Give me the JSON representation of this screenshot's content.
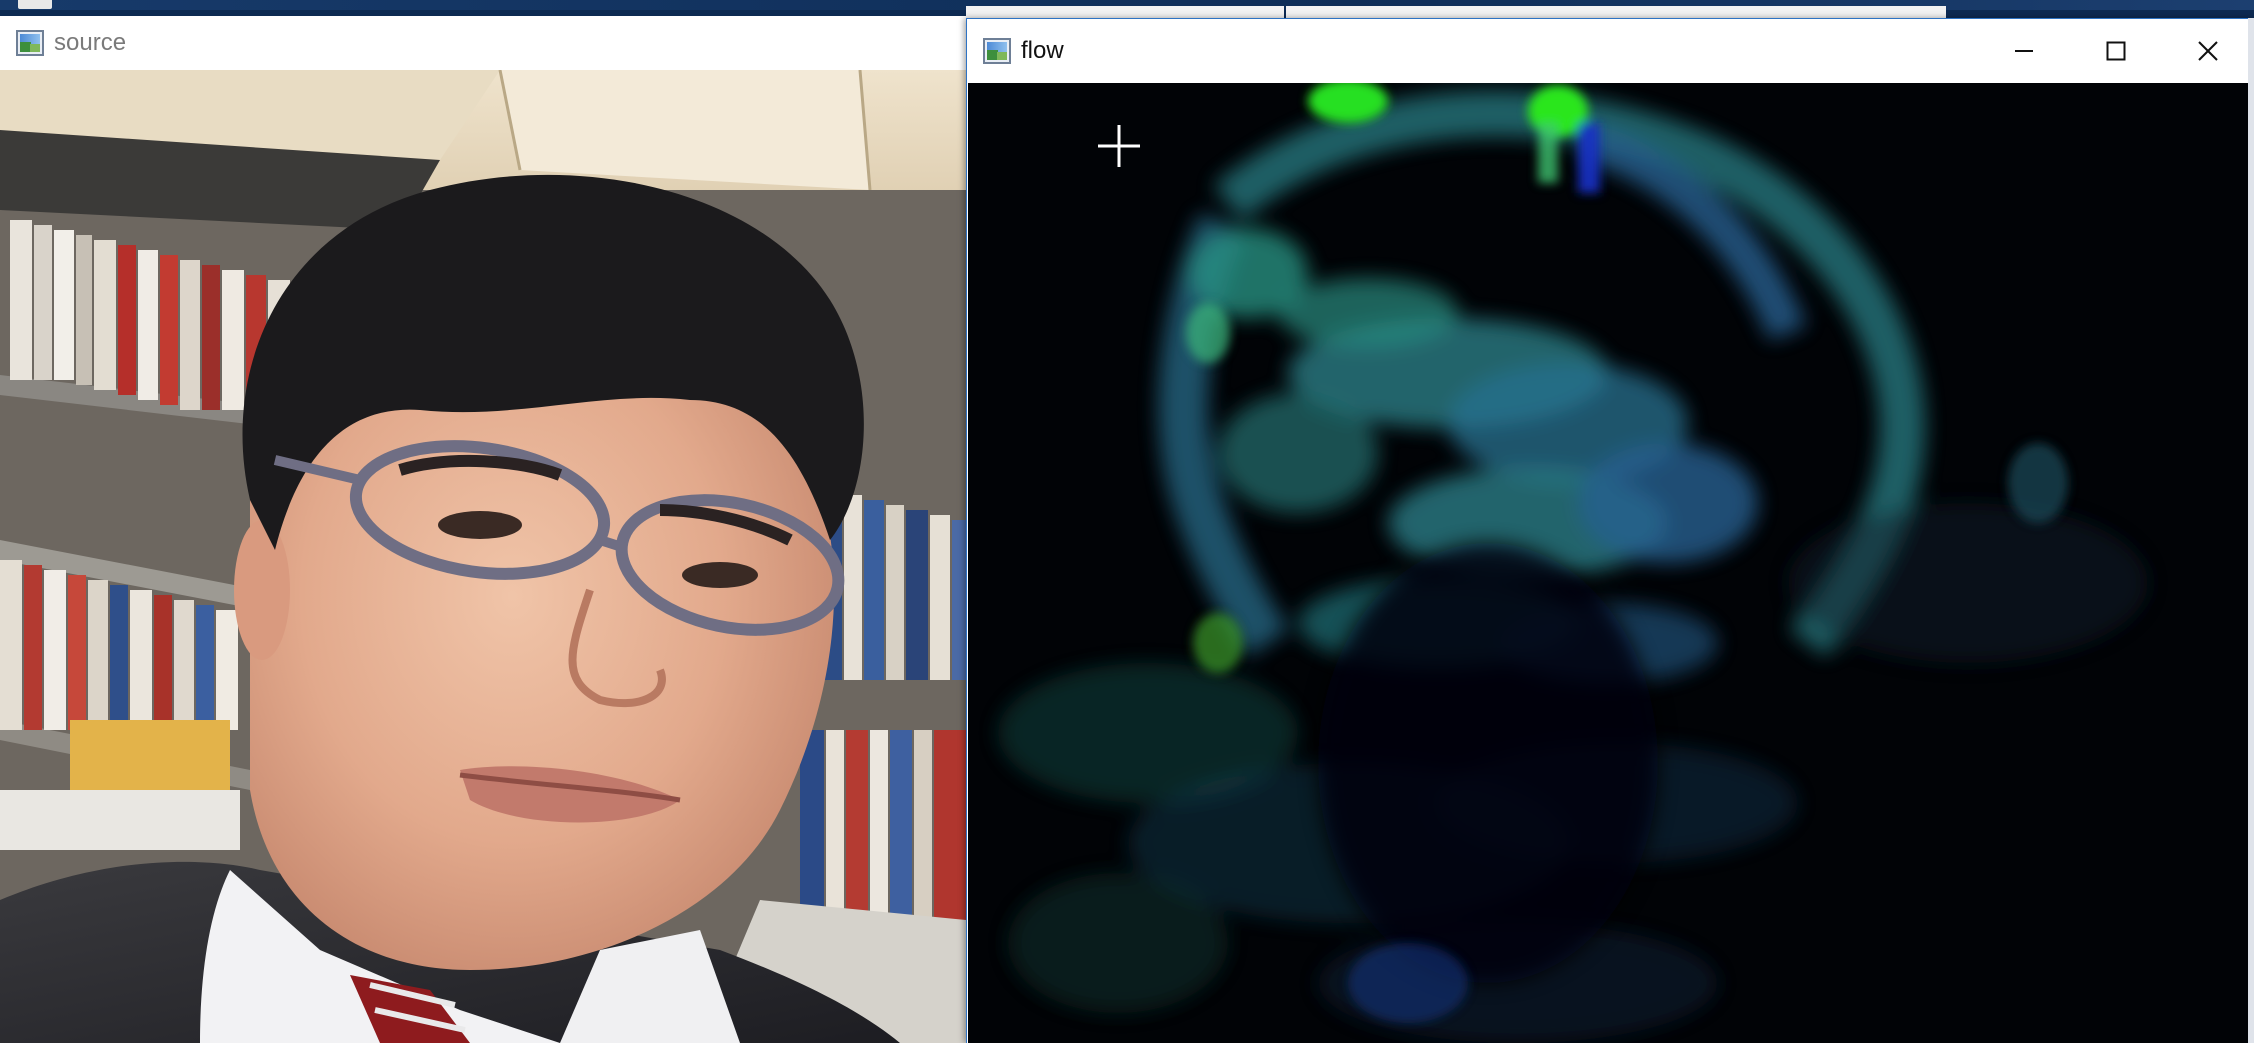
{
  "windows": {
    "source": {
      "title": "source",
      "icon": "opencv-highgui-window-icon"
    },
    "flow": {
      "title": "flow",
      "icon": "opencv-highgui-window-icon",
      "caption_buttons": [
        "minimize-icon",
        "maximize-icon",
        "close-icon"
      ],
      "cursor": "crosshair-cursor-icon"
    }
  },
  "colors": {
    "flow_background": "#010306",
    "flow_cyan": "#2f8c93",
    "flow_blue": "#2d6ba0",
    "flow_green": "#28e020",
    "flow_deep_blue": "#1a32c8",
    "active_border": "#2e73c4"
  }
}
